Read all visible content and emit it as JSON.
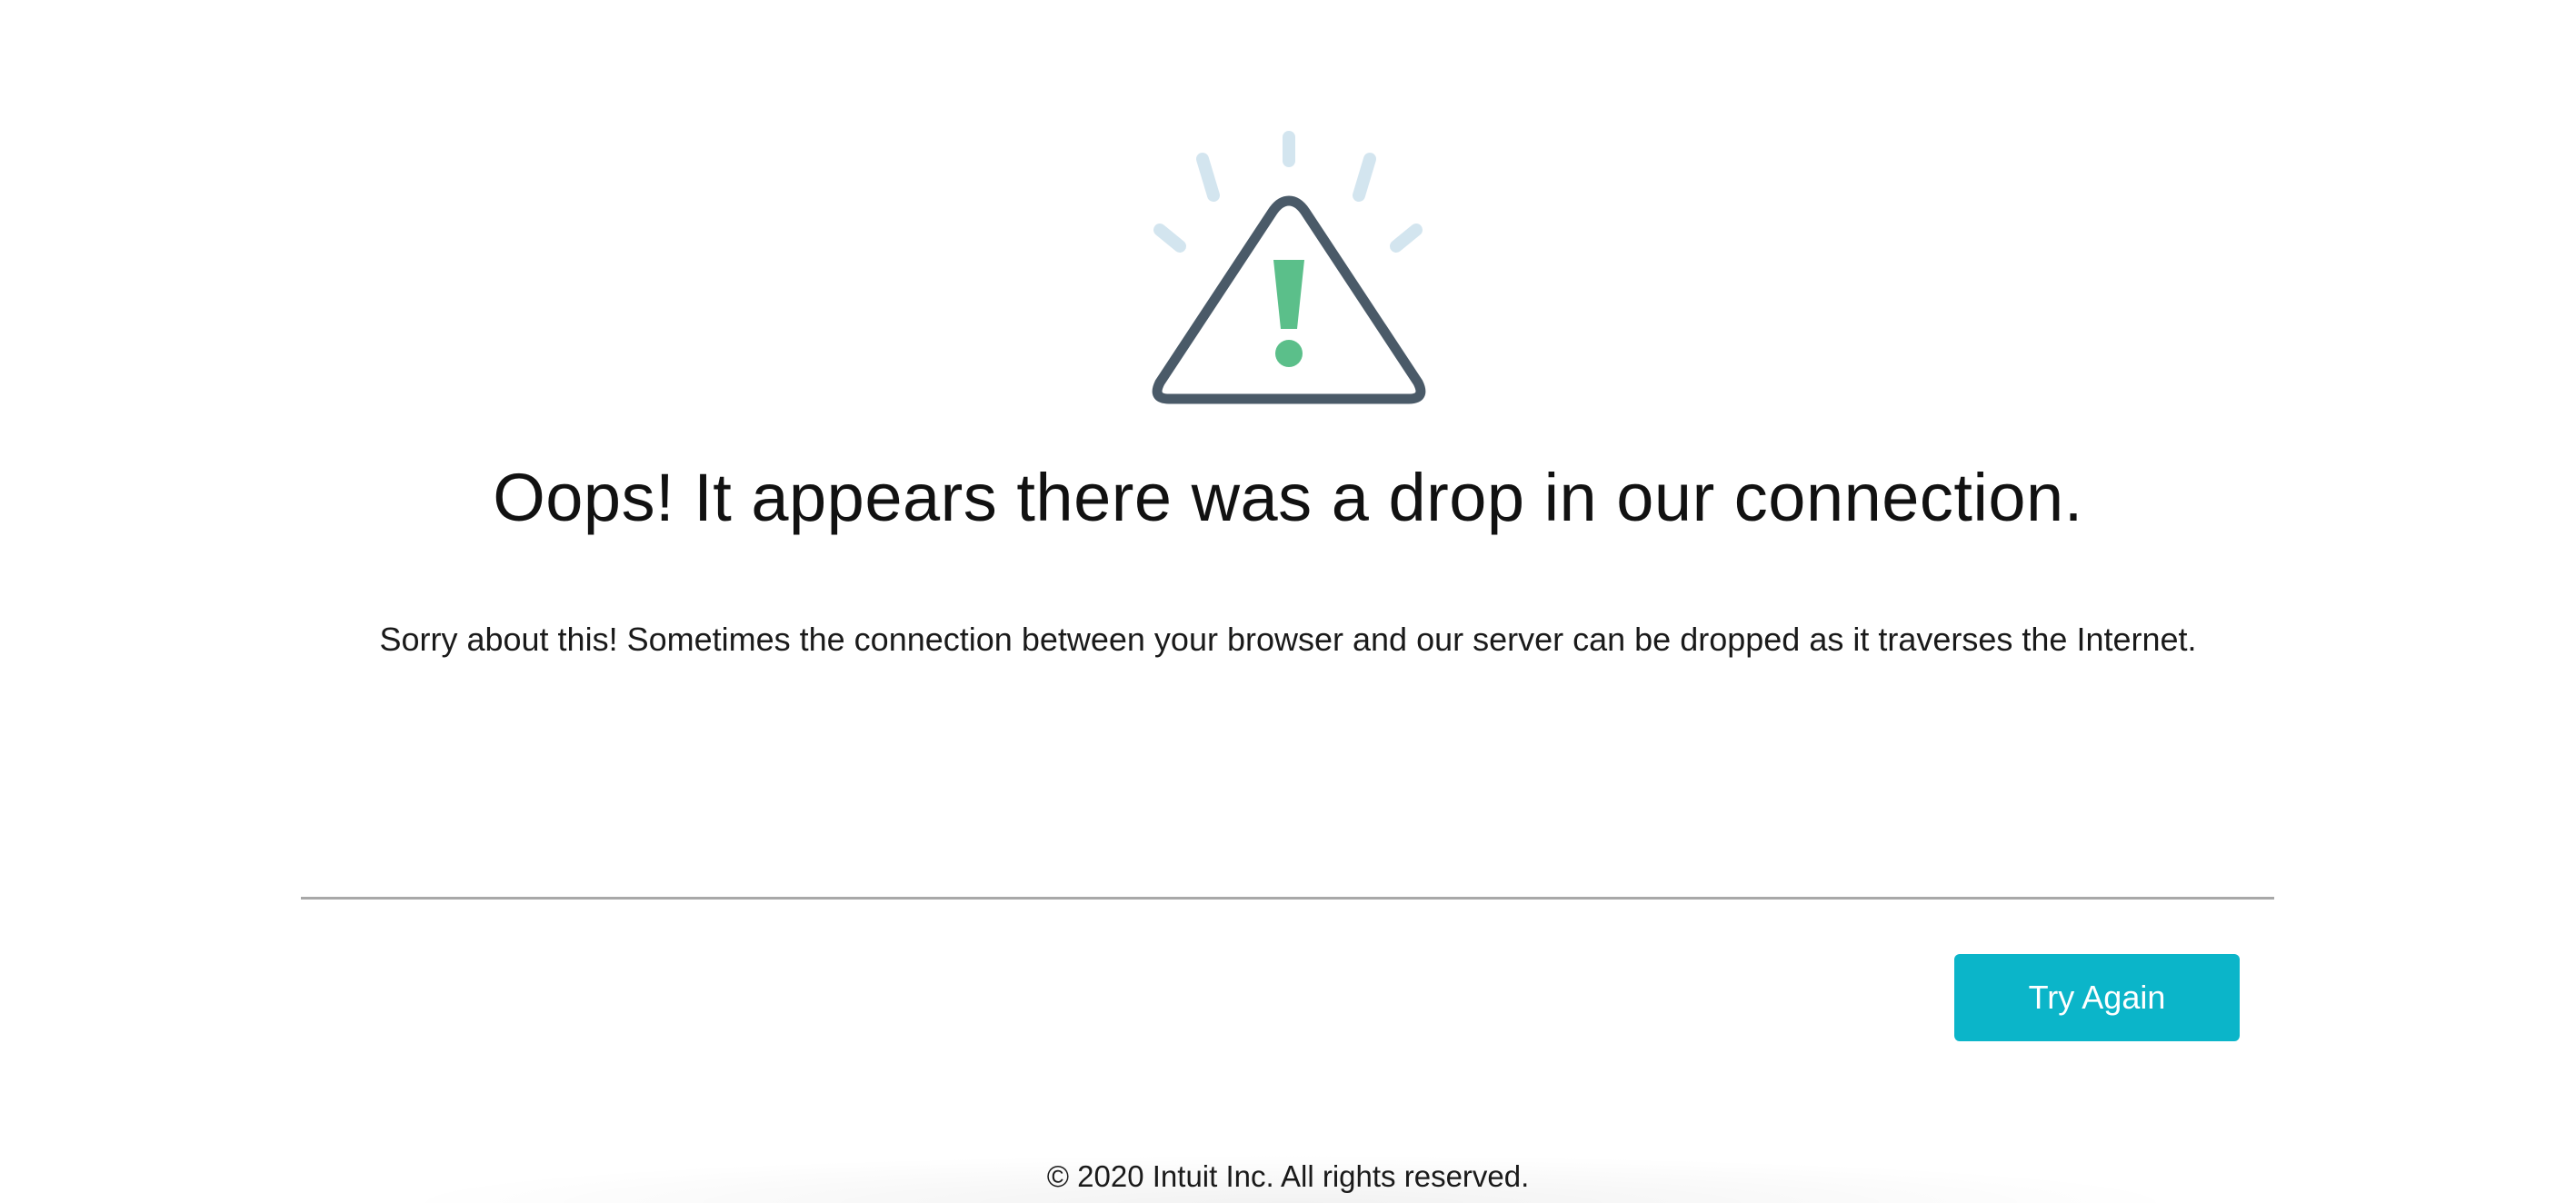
{
  "error": {
    "icon": "warning-triangle-icon",
    "headline": "Oops! It appears there was a drop in our connection.",
    "message": "Sorry about this! Sometimes the connection between your browser and our server can be dropped as it traverses the Internet."
  },
  "actions": {
    "try_again_label": "Try Again"
  },
  "footer": {
    "copyright": "© 2020 Intuit Inc. All rights reserved."
  },
  "colors": {
    "button": "#0bb5c9",
    "triangle_outline": "#4a5a68",
    "exclamation": "#5bbf8a",
    "rays": "#d3e5ef"
  }
}
